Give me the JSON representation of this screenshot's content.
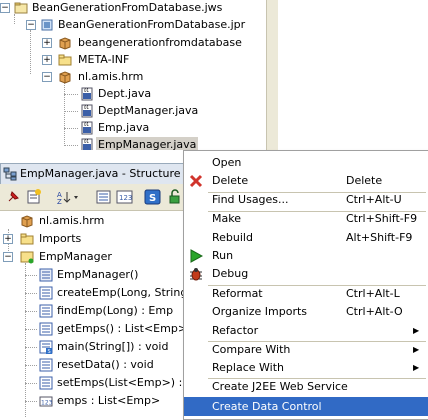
{
  "project_tree": {
    "workspace": "BeanGenerationFromDatabase.jws",
    "project": "BeanGenerationFromDatabase.jpr",
    "items": [
      {
        "label": "beangenerationfromdatabase"
      },
      {
        "label": "META-INF"
      },
      {
        "label": "nl.amis.hrm"
      }
    ],
    "files": [
      "Dept.java",
      "DeptManager.java",
      "Emp.java",
      "EmpManager.java"
    ]
  },
  "structure": {
    "title": "EmpManager.java - Structure",
    "package": "nl.amis.hrm",
    "imports": "Imports",
    "class": "EmpManager",
    "members": [
      "EmpManager()",
      "createEmp(Long, String",
      "findEmp(Long) : Emp",
      "getEmps() : List<Emp>",
      "main(String[]) : void",
      "resetData() : void",
      "setEmps(List<Emp>) :",
      "emps : List<Emp>"
    ]
  },
  "context_menu": {
    "items": [
      {
        "label": "Open",
        "shortcut": ""
      },
      {
        "label": "Delete",
        "shortcut": "Delete"
      },
      {
        "label": "Find Usages...",
        "shortcut": "Ctrl+Alt-U"
      },
      {
        "label": "Make",
        "shortcut": "Ctrl+Shift-F9"
      },
      {
        "label": "Rebuild",
        "shortcut": "Alt+Shift-F9"
      },
      {
        "label": "Run",
        "shortcut": ""
      },
      {
        "label": "Debug",
        "shortcut": ""
      },
      {
        "label": "Reformat",
        "shortcut": "Ctrl+Alt-L"
      },
      {
        "label": "Organize Imports",
        "shortcut": "Ctrl+Alt-O"
      },
      {
        "label": "Refactor",
        "shortcut": ""
      },
      {
        "label": "Compare With",
        "shortcut": ""
      },
      {
        "label": "Replace With",
        "shortcut": ""
      },
      {
        "label": "Create J2EE Web Service",
        "shortcut": ""
      },
      {
        "label": "Create Data Control",
        "shortcut": ""
      }
    ]
  },
  "colors": {
    "highlight": "#316ac5",
    "delete_icon": "#d0342c",
    "run_icon": "#2aa52a",
    "debug_icon": "#c23b1a"
  }
}
